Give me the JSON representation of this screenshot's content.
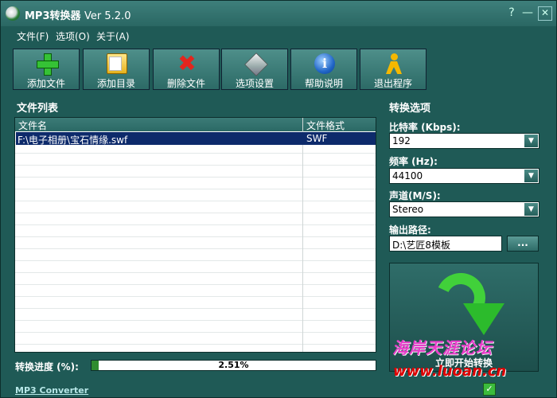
{
  "window": {
    "title": "MP3转换器",
    "version": "Ver 5.2.0",
    "controls": {
      "help": "?",
      "minimize": "—",
      "close": "✕"
    }
  },
  "menu": {
    "items": [
      "文件(F)",
      "选项(O)",
      "关于(A)"
    ]
  },
  "toolbar": {
    "buttons": [
      {
        "label": "添加文件",
        "icon": "plus-icon"
      },
      {
        "label": "添加目录",
        "icon": "folder-icon"
      },
      {
        "label": "删除文件",
        "icon": "delete-x-icon"
      },
      {
        "label": "选项设置",
        "icon": "settings-cube-icon"
      },
      {
        "label": "帮助说明",
        "icon": "info-icon"
      },
      {
        "label": "退出程序",
        "icon": "exit-person-icon"
      }
    ]
  },
  "file_list": {
    "title": "文件列表",
    "columns": [
      "文件名",
      "文件格式"
    ],
    "rows": [
      {
        "name": "F:\\电子相册\\宝石情缘.swf",
        "format": "SWF"
      }
    ]
  },
  "progress": {
    "label": "转换进度 (%):",
    "value_text": "2.51%",
    "value": 2.51
  },
  "status": {
    "app_name": "MP3 Converter"
  },
  "options": {
    "title": "转换选项",
    "bitrate": {
      "label": "比特率 (Kbps):",
      "value": "192"
    },
    "frequency": {
      "label": "频率 (Hz):",
      "value": "44100"
    },
    "channel": {
      "label": "声道(M/S):",
      "value": "Stereo"
    },
    "output": {
      "label": "输出路径:",
      "value": "D:\\艺匠8模板",
      "browse": "..."
    },
    "convert_label": "立即开始转换"
  },
  "watermark": {
    "text": "海岸天涯论坛",
    "url": "www.luoan.cn"
  },
  "colors": {
    "background": "#1f5a56",
    "selection": "#0d2a6b",
    "progress": "#2f8c2f",
    "accent_green": "#41d13a"
  }
}
